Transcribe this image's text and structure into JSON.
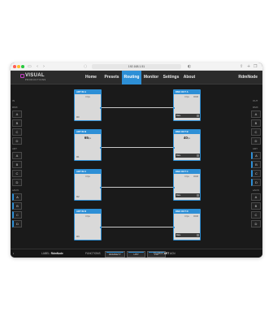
{
  "browser": {
    "url": "192.168.1.51",
    "back_icon": "chevron-left-icon",
    "forward_icon": "chevron-right-icon"
  },
  "app": {
    "logo_main": "VISUAL",
    "logo_sub": "PRODUCTIONS",
    "nav": [
      "Home",
      "Presets",
      "Routing",
      "Monitor",
      "Settings",
      "About"
    ],
    "active_nav": "Routing",
    "user": "RdmNode",
    "accent_color": "#2d8fd6"
  },
  "left_panel": {
    "label_top": "IN",
    "group1_label": "DMX",
    "group1": [
      "A",
      "B",
      "C",
      "D"
    ],
    "group2_label": "ART",
    "group2": [
      "A",
      "B",
      "C",
      "D"
    ],
    "group3_label": "sACN",
    "group3": [
      "A",
      "B",
      "C",
      "D"
    ]
  },
  "right_panel": {
    "label_top": "OUT",
    "group1_label": "DMX",
    "group1": [
      "A",
      "B",
      "C",
      "D"
    ],
    "group2_label": "ART",
    "group2": [
      "A",
      "B",
      "C",
      "D"
    ],
    "group3_label": "sACN",
    "group3": [
      "A",
      "B",
      "C",
      "D"
    ]
  },
  "inputs": [
    {
      "title": "ART IN A",
      "sub": "0 fps",
      "big": "",
      "unit": "",
      "foot": "0/0"
    },
    {
      "title": "ART IN B",
      "sub": "",
      "big": "65",
      "unit": "fps",
      "foot": "0/1"
    },
    {
      "title": "ART IN C",
      "sub": "0 fps",
      "big": "",
      "unit": "",
      "foot": "0/2"
    },
    {
      "title": "ART IN D",
      "sub": "0 fps",
      "big": "",
      "unit": "",
      "foot": "0/3"
    }
  ],
  "outputs": [
    {
      "title": "DMX OUT A",
      "sub": "0 fps",
      "corner": "RDM",
      "big": "",
      "unit": "",
      "bar_label": "Rate"
    },
    {
      "title": "DMX OUT B",
      "sub": "",
      "corner": "",
      "big": "40",
      "unit": "fps",
      "bar_label": "Rate"
    },
    {
      "title": "DMX OUT C",
      "sub": "0 fps",
      "corner": "RDM",
      "big": "",
      "unit": "",
      "bar_label": "Rate"
    },
    {
      "title": "DMX OUT D",
      "sub": "0 fps",
      "corner": "RDM",
      "big": "",
      "unit": "",
      "bar_label": "Rate"
    }
  ],
  "bottom": {
    "label_prefix": "LABEL:",
    "label_value": "RdmNode",
    "functions_label": "FUNCTIONS",
    "buttons": [
      "RDMDETY",
      "HTP",
      "LTP"
    ],
    "status_prefix": "F1 DMX",
    "status_bold": "ART",
    "status_suffix": "ACN"
  }
}
